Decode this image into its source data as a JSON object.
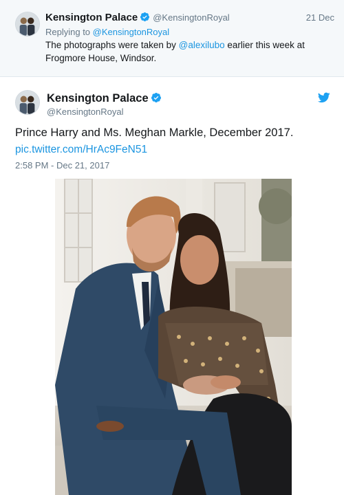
{
  "reply_tweet": {
    "name": "Kensington Palace",
    "handle": "@KensingtonRoyal",
    "date": "21 Dec",
    "replying_prefix": "Replying to ",
    "replying_to": "@KensingtonRoyal",
    "text_before": "The photographs were taken by ",
    "mention": "@alexilubo",
    "text_after": " earlier this week at Frogmore House, Windsor."
  },
  "main_tweet": {
    "name": "Kensington Palace",
    "handle": "@KensingtonRoyal",
    "text": "Prince Harry and Ms. Meghan Markle, December 2017.",
    "link": "pic.twitter.com/HrAc9FeN51",
    "timestamp": "2:58 PM - Dec 21, 2017"
  },
  "icons": {
    "verified": "verified-badge-icon",
    "twitter": "twitter-bird-icon"
  },
  "colors": {
    "link": "#1b95e0",
    "verified": "#1da1f2",
    "secondary_text": "#657786",
    "reply_background": "#f5f8fa"
  }
}
